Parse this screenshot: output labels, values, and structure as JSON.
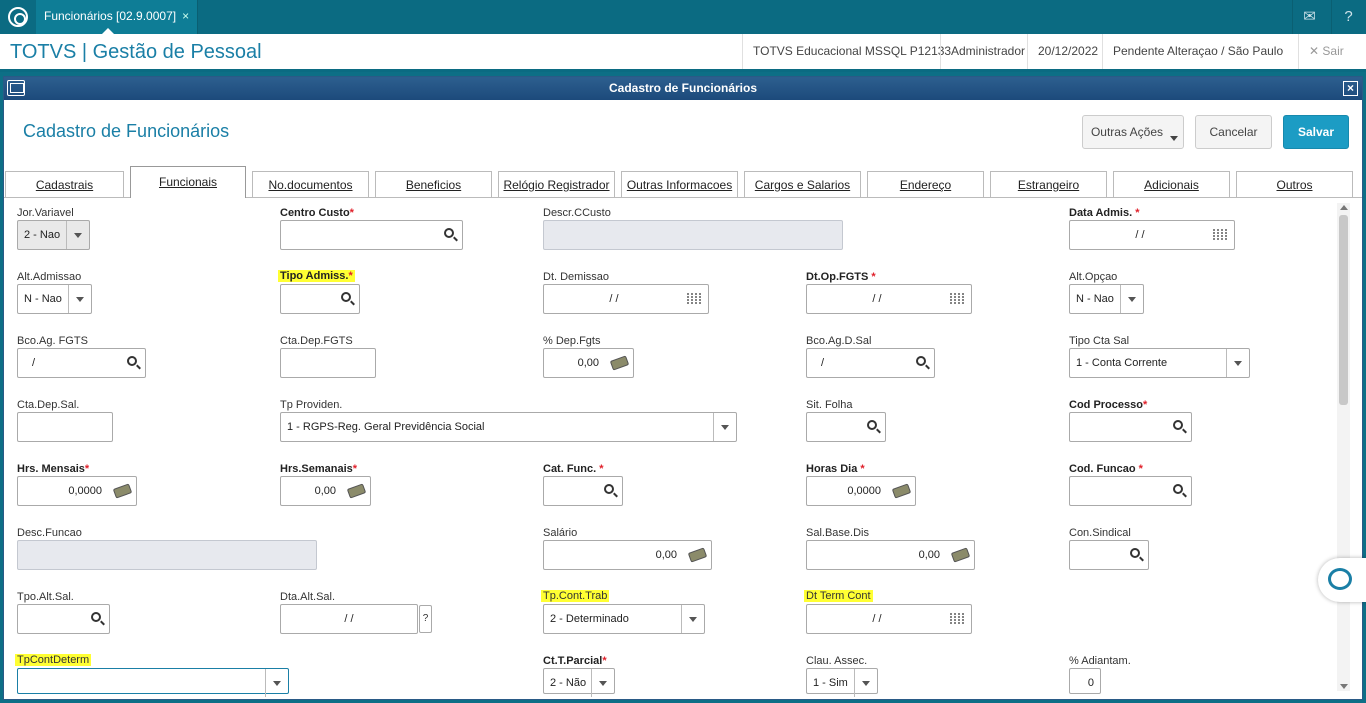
{
  "topbar": {
    "tab_label": "Funcionários [02.9.0007]",
    "tab_close": "×"
  },
  "header": {
    "title": "TOTVS | Gestão de Pessoal",
    "environment": "TOTVS Educacional MSSQL P12133",
    "user": "Administrador",
    "date": "20/12/2022",
    "status": "Pendente Alteraçao / São Paulo",
    "exit_label": "Sair"
  },
  "window": {
    "title": "Cadastro de Funcionários",
    "close": "×"
  },
  "form": {
    "title": "Cadastro de Funcionários",
    "actions": {
      "other": "Outras Ações",
      "cancel": "Cancelar",
      "save": "Salvar"
    }
  },
  "tabs": [
    "Cadastrais",
    "Funcionais",
    "No.documentos",
    "Beneficios",
    "Relógio Registrador",
    "Outras Informacoes",
    "Cargos e Salarios",
    "Endereço",
    "Estrangeiro",
    "Adicionais",
    "Outros"
  ],
  "fields": {
    "jor_variavel": {
      "label": "Jor.Variavel",
      "value": "2 - Nao"
    },
    "centro_custo": {
      "label": "Centro Custo",
      "req": "*",
      "value": ""
    },
    "descr_ccusto": {
      "label": "Descr.CCusto",
      "value": ""
    },
    "data_admis": {
      "label": "Data Admis.",
      "req": " *",
      "value": "/ /"
    },
    "alt_admissao": {
      "label": "Alt.Admissao",
      "value": "N - Nao"
    },
    "tipo_admiss": {
      "label": "Tipo Admiss.",
      "req": "*",
      "value": ""
    },
    "dt_demissao": {
      "label": "Dt. Demissao",
      "value": "/ /"
    },
    "dt_op_fgts": {
      "label": "Dt.Op.FGTS",
      "req": " *",
      "value": "/ /"
    },
    "alt_opcao": {
      "label": "Alt.Opçao",
      "value": "N - Nao"
    },
    "bco_ag_fgts": {
      "label": "Bco.Ag. FGTS",
      "value": "/"
    },
    "cta_dep_fgts": {
      "label": "Cta.Dep.FGTS",
      "value": ""
    },
    "pct_dep_fgts": {
      "label": "% Dep.Fgts",
      "value": "0,00"
    },
    "bco_ag_d_sal": {
      "label": "Bco.Ag.D.Sal",
      "value": "/"
    },
    "tipo_cta_sal": {
      "label": "Tipo Cta Sal",
      "value": "1 - Conta Corrente"
    },
    "cta_dep_sal": {
      "label": "Cta.Dep.Sal.",
      "value": ""
    },
    "tp_providen": {
      "label": "Tp Providen.",
      "value": "1 - RGPS-Reg. Geral Previdência Social"
    },
    "sit_folha": {
      "label": "Sit. Folha",
      "value": ""
    },
    "cod_processo": {
      "label": "Cod Processo",
      "req": "*",
      "value": ""
    },
    "hrs_mensais": {
      "label": "Hrs. Mensais",
      "req": "*",
      "value": "0,0000"
    },
    "hrs_semanais": {
      "label": "Hrs.Semanais",
      "req": "*",
      "value": "0,00"
    },
    "cat_func": {
      "label": "Cat. Func.",
      "req": " *",
      "value": ""
    },
    "horas_dia": {
      "label": "Horas Dia",
      "req": " *",
      "value": "0,0000"
    },
    "cod_funcao": {
      "label": "Cod. Funcao",
      "req": " *",
      "value": ""
    },
    "desc_funcao": {
      "label": "Desc.Funcao",
      "value": ""
    },
    "salario": {
      "label": "Salário",
      "value": "0,00"
    },
    "sal_base_dis": {
      "label": "Sal.Base.Dis",
      "value": "0,00"
    },
    "con_sindical": {
      "label": "Con.Sindical",
      "value": ""
    },
    "tpo_alt_sal": {
      "label": "Tpo.Alt.Sal.",
      "value": ""
    },
    "dta_alt_sal": {
      "label": "Dta.Alt.Sal.",
      "value": "/ /",
      "help": "?"
    },
    "tp_cont_trab": {
      "label": "Tp.Cont.Trab",
      "value": "2 - Determinado"
    },
    "dt_term_cont": {
      "label": "Dt Term Cont",
      "value": "/ /"
    },
    "tp_cont_determ": {
      "label": "TpContDeterm",
      "value": ""
    },
    "ct_t_parcial": {
      "label": "Ct.T.Parcial",
      "req": "*",
      "value": "2 - Não"
    },
    "clau_assec": {
      "label": "Clau. Assec.",
      "value": "1 - Sim"
    },
    "pct_adiantam": {
      "label": "% Adiantam.",
      "value": "0"
    }
  },
  "colors": {
    "teal": "#0b6b82",
    "accent": "#1a7fa6",
    "required": "#e0202a",
    "highlight": "#ffff33"
  }
}
